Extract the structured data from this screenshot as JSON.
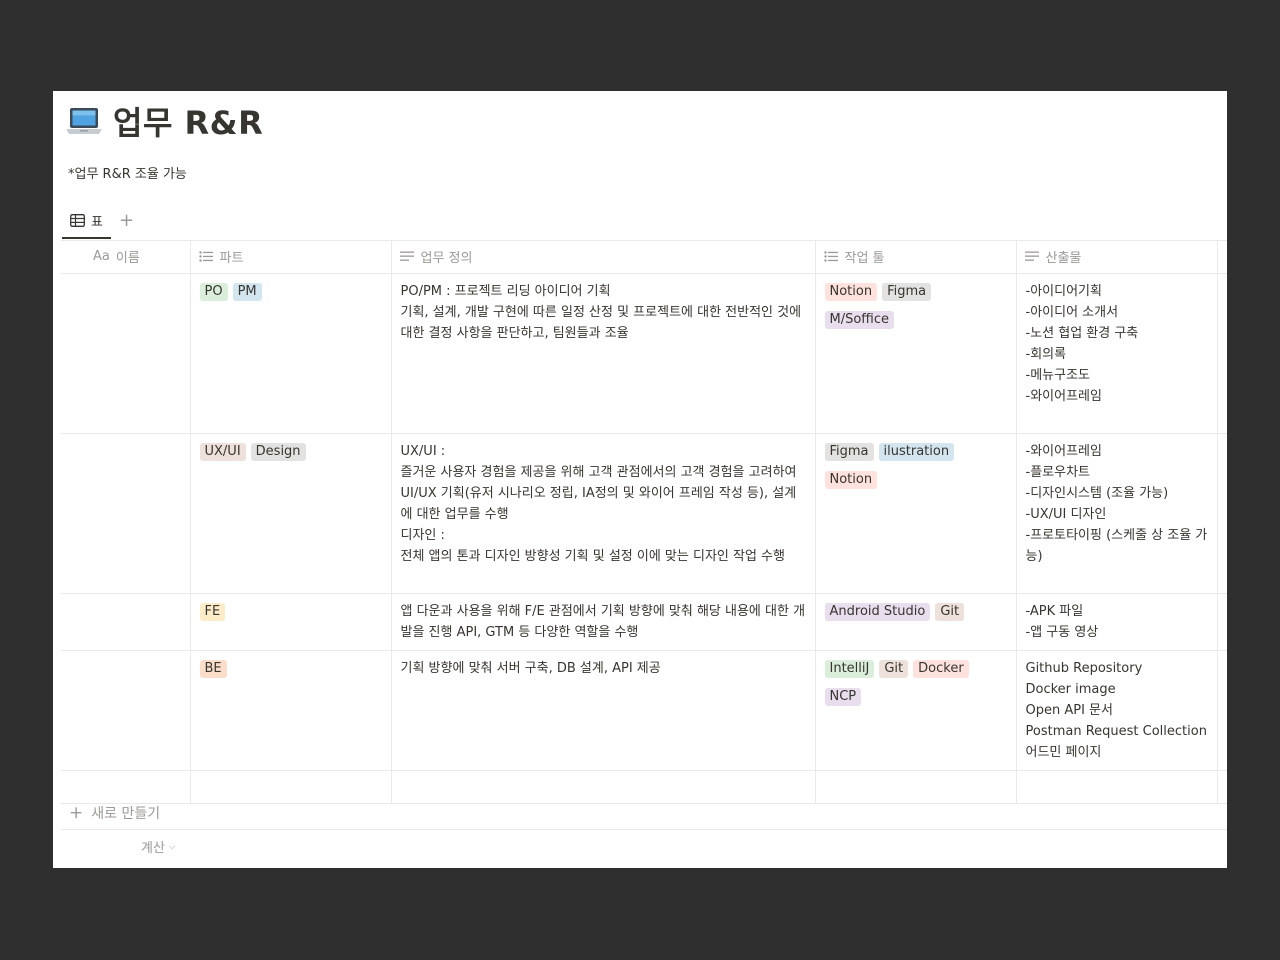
{
  "page": {
    "title": "업무 R&R",
    "note": "*업무 R&R 조율 가능"
  },
  "tabs": [
    {
      "label": "표"
    }
  ],
  "columns": {
    "name": {
      "prefix": "Aa",
      "label": "이름"
    },
    "part": {
      "label": "파트"
    },
    "definition": {
      "label": "업무 정의"
    },
    "tools": {
      "label": "작업 툴"
    },
    "output": {
      "label": "산출물"
    }
  },
  "rows": [
    {
      "part": [
        {
          "label": "PO",
          "bg": "#dbeddb"
        },
        {
          "label": "PM",
          "bg": "#d3e5ef"
        }
      ],
      "definition": [
        "PO/PM : 프로젝트 리딩 아이디어 기획",
        "기획, 설계, 개발 구현에 따른 일정 산정 및 프로젝트에 대한 전반적인 것에 대한 결정 사항을 판단하고, 팀원들과 조율"
      ],
      "tools": [
        {
          "label": "Notion",
          "bg": "#ffe2dd"
        },
        {
          "label": "Figma",
          "bg": "#e3e2e0"
        },
        {
          "label": "M/Soffice",
          "bg": "#e8deee"
        }
      ],
      "output": [
        "-아이디어기획",
        "-아이디어 소개서",
        "-노션 협업 환경 구축",
        "-회의록",
        "-메뉴구조도",
        "-와이어프레임"
      ]
    },
    {
      "part": [
        {
          "label": "UX/UI",
          "bg": "#eee0da"
        },
        {
          "label": "Design",
          "bg": "#e3e2e0"
        }
      ],
      "definition": [
        "UX/UI :",
        "즐거운 사용자 경험을 제공을 위해 고객 관점에서의 고객 경험을 고려하여 UI/UX 기획(유저 시나리오 정립, IA정의 및 와이어 프레임 작성 등), 설계에 대한 업무를 수행",
        "디자인 :",
        "전체 앱의 톤과 디자인 방향성 기획 및 설정 이에 맞는 디자인 작업 수행"
      ],
      "tools": [
        {
          "label": "Figma",
          "bg": "#e3e2e0"
        },
        {
          "label": "ilustration",
          "bg": "#d3e5ef"
        },
        {
          "label": "Notion",
          "bg": "#ffe2dd"
        }
      ],
      "output": [
        "-와이어프레임",
        "-플로우차트",
        "-디자인시스템 (조율 가능)",
        "-UX/UI 디자인",
        "-프로토타이핑 (스케줄 상 조율 가능)"
      ]
    },
    {
      "part": [
        {
          "label": "FE",
          "bg": "#fdecc8"
        }
      ],
      "definition": [
        "앱 다운과 사용을 위해 F/E 관점에서 기획 방향에 맞춰 해당 내용에 대한 개발을 진행 API, GTM 등 다양한 역할을 수행"
      ],
      "tools": [
        {
          "label": "Android Studio",
          "bg": "#e8deee"
        },
        {
          "label": "Git",
          "bg": "#eee0da"
        }
      ],
      "output": [
        "-APK 파일",
        "-앱 구동 영상"
      ]
    },
    {
      "part": [
        {
          "label": "BE",
          "bg": "#fadec9"
        }
      ],
      "definition": [
        "기획 방향에 맞춰 서버 구축, DB 설계, API 제공"
      ],
      "tools": [
        {
          "label": "IntelliJ",
          "bg": "#dbeddb"
        },
        {
          "label": "Git",
          "bg": "#eee0da"
        },
        {
          "label": "Docker",
          "bg": "#ffe2dd"
        },
        {
          "label": "NCP",
          "bg": "#e8deee"
        }
      ],
      "output": [
        "Github Repository",
        "Docker image",
        "Open API 문서",
        "Postman Request Collection",
        "어드민 페이지"
      ]
    }
  ],
  "footer": {
    "new_label": "새로 만들기",
    "calc_label": "계산"
  },
  "icons": {
    "page": "laptop-icon",
    "tab": "table-icon",
    "add": "plus-icon",
    "part": "list-icon",
    "definition": "text-lines-icon",
    "tools": "list-icon",
    "output": "text-lines-icon",
    "calc": "chevron-down-icon"
  }
}
